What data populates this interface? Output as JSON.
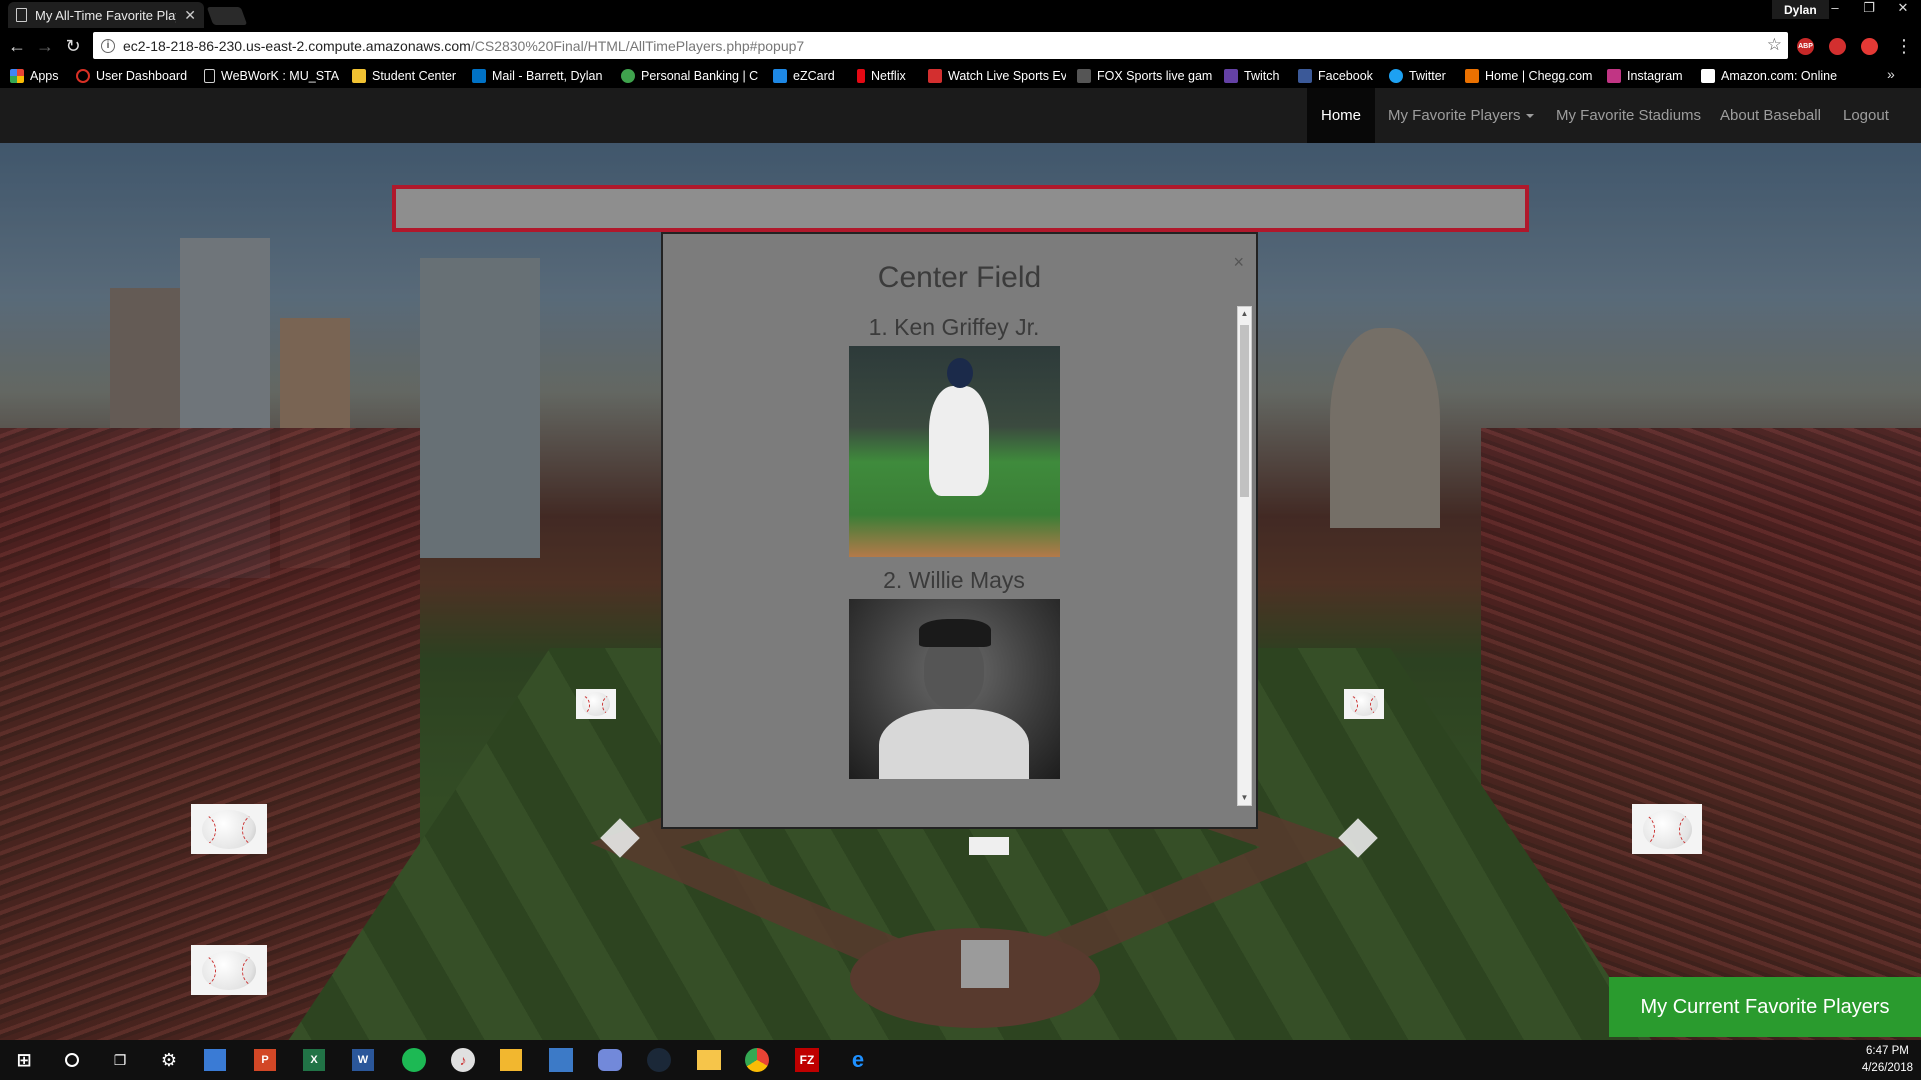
{
  "browser": {
    "tab_title": "My All-Time Favorite Play",
    "profile_name": "Dylan",
    "url_host": "ec2-18-218-86-230.us-east-2.compute.amazonaws.com",
    "url_path": "/CS2830%20Final/HTML/AllTimePlayers.php#popup7",
    "extensions": [
      "ABP",
      "ext-red",
      "ext-red-2"
    ]
  },
  "bookmarks": [
    {
      "label": "Apps",
      "icon": "apps-grid-icon",
      "color": "#e94335"
    },
    {
      "label": "User Dashboard",
      "icon": "dashboard-icon",
      "color": "#d93025"
    },
    {
      "label": "WeBWorK : MU_STA",
      "icon": "page-icon",
      "color": "#cfcfcf"
    },
    {
      "label": "Student Center",
      "icon": "university-icon",
      "color": "#f1c232"
    },
    {
      "label": "Mail - Barrett, Dylan",
      "icon": "outlook-icon",
      "color": "#0072c6"
    },
    {
      "label": "Personal Banking | C",
      "icon": "bank-icon",
      "color": "#3fa34d"
    },
    {
      "label": "eZCard",
      "icon": "ezcard-icon",
      "color": "#1e88e5"
    },
    {
      "label": "Netflix",
      "icon": "netflix-icon",
      "color": "#e50914"
    },
    {
      "label": "Watch Live Sports Ev",
      "icon": "sports-icon",
      "color": "#d32f2f"
    },
    {
      "label": "FOX Sports live gam",
      "icon": "fox-icon",
      "color": "#555555"
    },
    {
      "label": "Twitch",
      "icon": "twitch-icon",
      "color": "#6441a5"
    },
    {
      "label": "Facebook",
      "icon": "facebook-icon",
      "color": "#3b5998"
    },
    {
      "label": "Twitter",
      "icon": "twitter-icon",
      "color": "#1da1f2"
    },
    {
      "label": "Home | Chegg.com",
      "icon": "chegg-icon",
      "color": "#eb7100"
    },
    {
      "label": "Instagram",
      "icon": "instagram-icon",
      "color": "#c13584"
    },
    {
      "label": "Amazon.com: Online",
      "icon": "amazon-icon",
      "color": "#ffffff"
    }
  ],
  "site_nav": {
    "home": "Home",
    "players": "My Favorite Players",
    "stadiums": "My Favorite Stadiums",
    "about": "About Baseball",
    "logout": "Logout"
  },
  "modal": {
    "title": "Center Field",
    "close": "×",
    "players": [
      {
        "name": "1. Ken Griffey Jr."
      },
      {
        "name": "2. Willie Mays"
      }
    ]
  },
  "fav_button": "My Current Favorite Players",
  "taskbar": {
    "time": "6:47 PM",
    "date": "4/26/2018"
  },
  "colors": {
    "accent_green": "#2a9b2e",
    "header_border_red": "#b0182b"
  }
}
